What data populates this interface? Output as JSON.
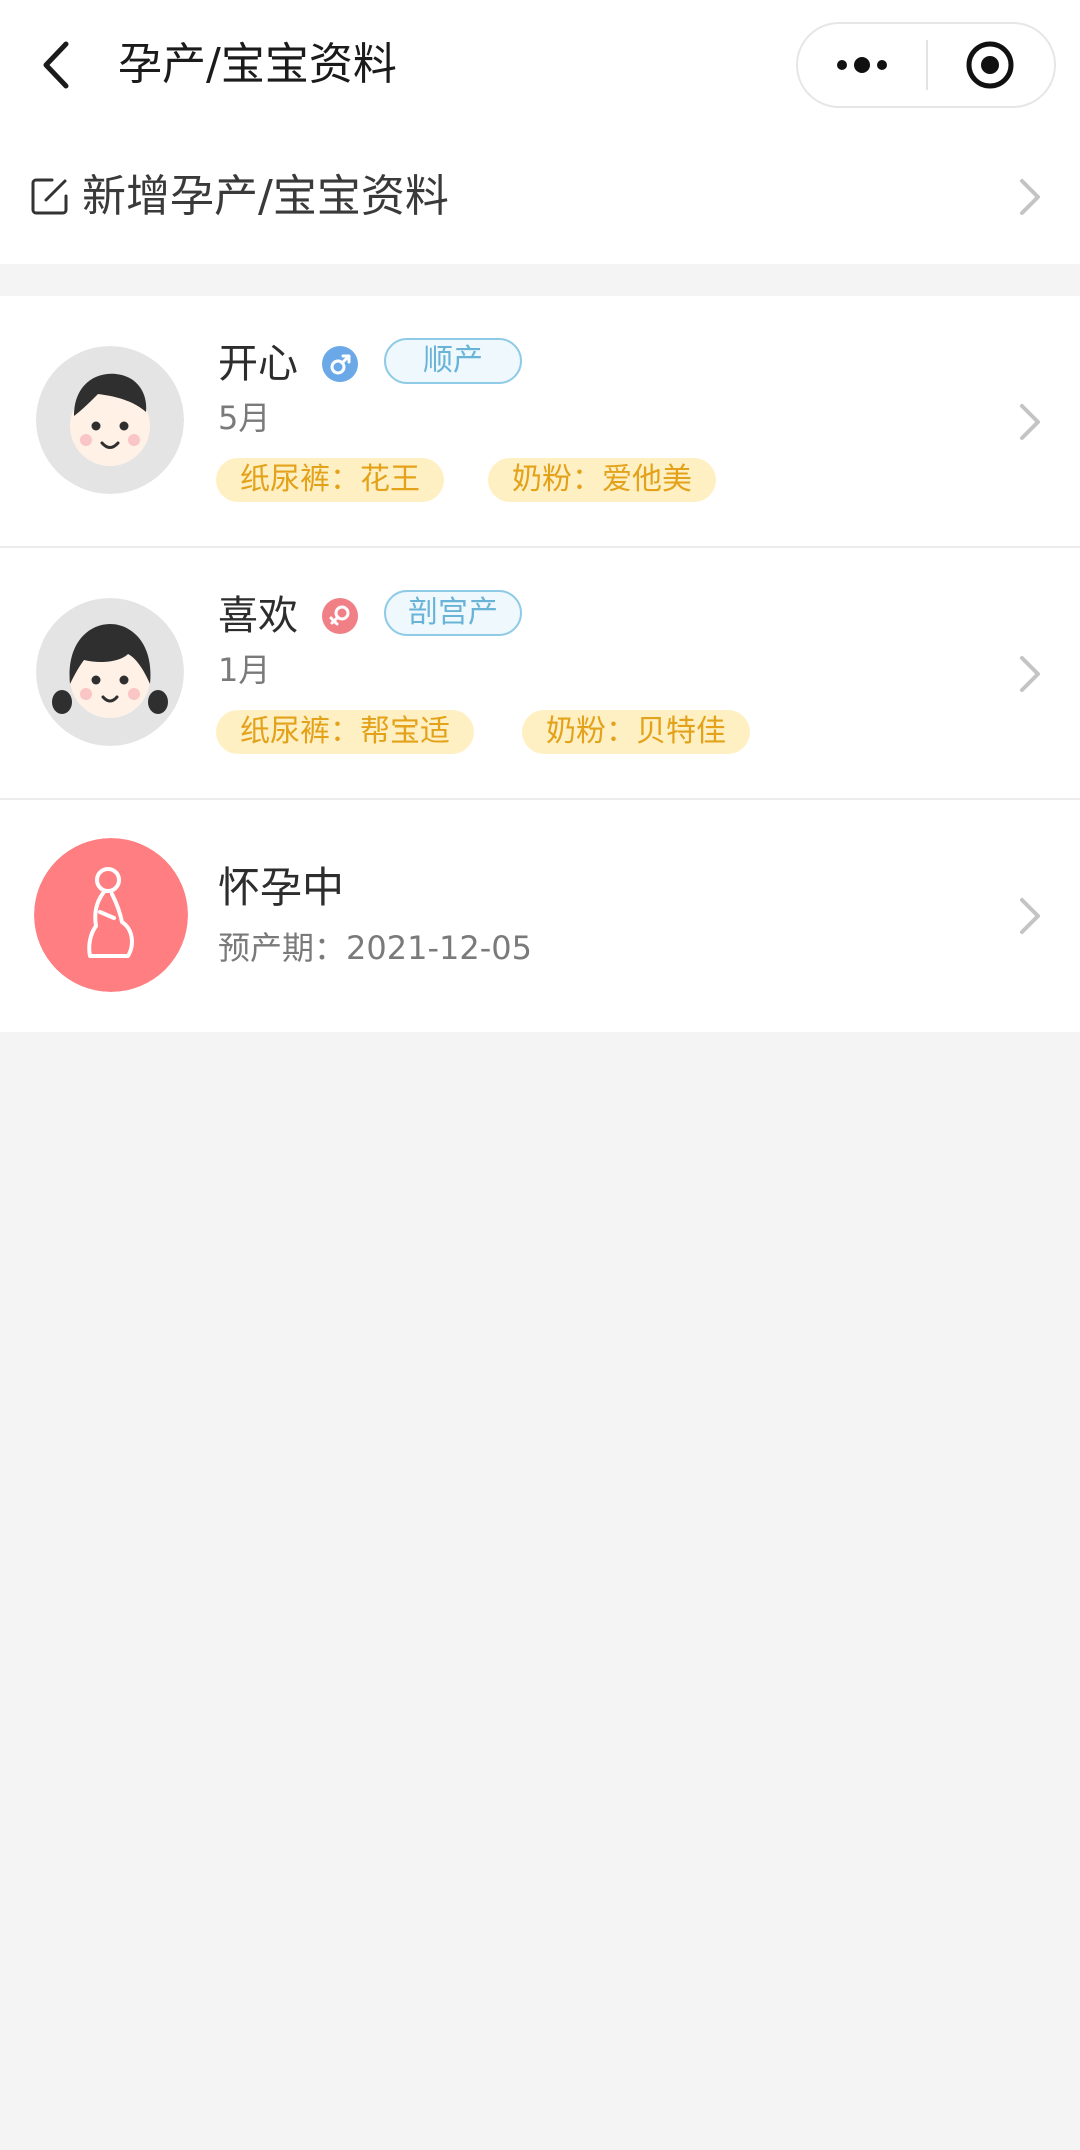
{
  "nav": {
    "title": "孕产/宝宝资料"
  },
  "add_row": {
    "label": "新增孕产/宝宝资料"
  },
  "babies": [
    {
      "name": "开心",
      "gender": "male",
      "gender_symbol": "♂",
      "birth_type": "顺产",
      "age": "5月",
      "tags": [
        "纸尿裤：花王",
        "奶粉：爱他美"
      ]
    },
    {
      "name": "喜欢",
      "gender": "female",
      "gender_symbol": "♀",
      "birth_type": "剖宫产",
      "age": "1月",
      "tags": [
        "纸尿裤：帮宝适",
        "奶粉：贝特佳"
      ]
    }
  ],
  "pregnancy": {
    "status": "怀孕中",
    "due_date": "预产期：2021-12-05"
  },
  "colors": {
    "male": "#6aa8e8",
    "female": "#f07f86",
    "tag_bg": "#fff0c4",
    "tag_text": "#e3a21a",
    "birth_tag_border": "#8fcbe6",
    "pregnancy_avatar": "#ff7e82"
  }
}
